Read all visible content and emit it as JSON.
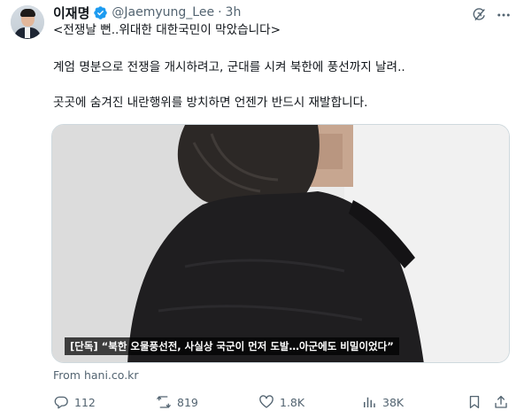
{
  "author": {
    "display_name": "이재명",
    "handle": "@Jaemyung_Lee",
    "separator": "·",
    "time": "3h",
    "verified": true,
    "avatar_icon": "profile-avatar"
  },
  "top_actions": {
    "grok_icon": "grok-icon",
    "more_icon": "more-icon"
  },
  "tweet": {
    "line1": "<전쟁날 뻔..위대한 대한국민이 막았습니다>",
    "line2": "계엄 명분으로 전쟁을 개시하려고, 군대를 시켜 북한에 풍선까지 날려..",
    "line3": "곳곳에 숨겨진 내란행위를 방치하면 언젠가 반드시 재발합니다."
  },
  "media": {
    "caption": "[단독] “북한 오물풍선전, 사실상 국군이 먼저 도발…아군에도 비밀이었다”"
  },
  "link": {
    "source": "From hani.co.kr"
  },
  "actions": {
    "replies": "112",
    "reposts": "819",
    "likes": "1.8K",
    "views": "38K"
  },
  "colors": {
    "text": "#0f1419",
    "muted": "#536471",
    "verified": "#1d9bf0",
    "border": "#cfd9de"
  }
}
